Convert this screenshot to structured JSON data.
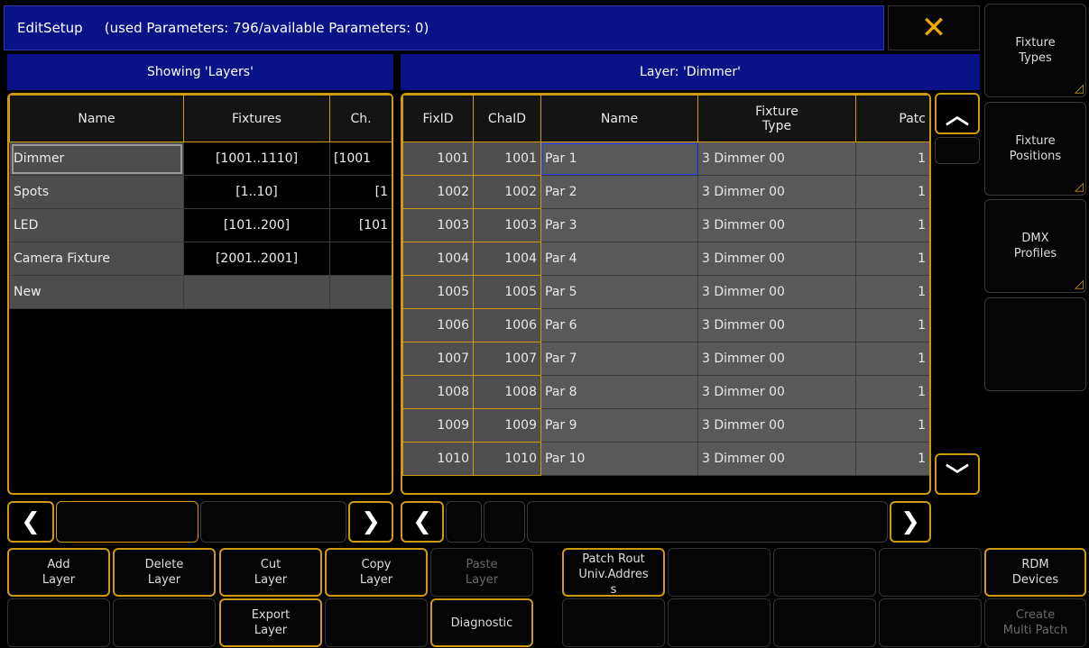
{
  "title": {
    "app": "EditSetup",
    "info": "(used Parameters: 796/available Parameters: 0)"
  },
  "close_label": "✕",
  "left": {
    "header": "Showing 'Layers'",
    "columns": [
      "Name",
      "Fixtures",
      "Ch."
    ],
    "rows": [
      {
        "name": "Dimmer",
        "fixtures": "[1001..1110]",
        "ch": "[1001"
      },
      {
        "name": "Spots",
        "fixtures": "[1..10]",
        "ch": "[1"
      },
      {
        "name": "LED",
        "fixtures": "[101..200]",
        "ch": "[101"
      },
      {
        "name": "Camera Fixture",
        "fixtures": "[2001..2001]",
        "ch": ""
      },
      {
        "name": "New",
        "fixtures": "",
        "ch": ""
      }
    ]
  },
  "right": {
    "header": "Layer: 'Dimmer'",
    "columns": [
      "FixID",
      "ChaID",
      "Name",
      "Fixture\nType",
      "Patc"
    ],
    "rows": [
      {
        "fix": "1001",
        "cha": "1001",
        "name": "Par 1",
        "type": "3 Dimmer 00",
        "patch": "1"
      },
      {
        "fix": "1002",
        "cha": "1002",
        "name": "Par 2",
        "type": "3 Dimmer 00",
        "patch": "1"
      },
      {
        "fix": "1003",
        "cha": "1003",
        "name": "Par 3",
        "type": "3 Dimmer 00",
        "patch": "1"
      },
      {
        "fix": "1004",
        "cha": "1004",
        "name": "Par 4",
        "type": "3 Dimmer 00",
        "patch": "1"
      },
      {
        "fix": "1005",
        "cha": "1005",
        "name": "Par 5",
        "type": "3 Dimmer 00",
        "patch": "1"
      },
      {
        "fix": "1006",
        "cha": "1006",
        "name": "Par 6",
        "type": "3 Dimmer 00",
        "patch": "1"
      },
      {
        "fix": "1007",
        "cha": "1007",
        "name": "Par 7",
        "type": "3 Dimmer 00",
        "patch": "1"
      },
      {
        "fix": "1008",
        "cha": "1008",
        "name": "Par 8",
        "type": "3 Dimmer 00",
        "patch": "1"
      },
      {
        "fix": "1009",
        "cha": "1009",
        "name": "Par 9",
        "type": "3 Dimmer 00",
        "patch": "1"
      },
      {
        "fix": "1010",
        "cha": "1010",
        "name": "Par 10",
        "type": "3 Dimmer 00",
        "patch": "1"
      }
    ]
  },
  "side": {
    "fixture_types": "Fixture\nTypes",
    "fixture_positions": "Fixture\nPositions",
    "dmx_profiles": "DMX\nProfiles",
    "rdm_devices": "RDM\nDevices",
    "create_multi_patch": "Create\nMulti Patch"
  },
  "buttons": {
    "add_layer": "Add\nLayer",
    "delete_layer": "Delete\nLayer",
    "cut_layer": "Cut\nLayer",
    "copy_layer": "Copy\nLayer",
    "paste_layer": "Paste\nLayer",
    "patch_route": "Patch Rout\nUniv.Addres\ns",
    "export_layer": "Export\nLayer",
    "diagnostic": "Diagnostic"
  },
  "icons": {
    "left": "chevron-left-icon",
    "right": "chevron-right-icon",
    "up": "chevron-up-icon",
    "down": "chevron-down-icon",
    "close": "close-icon"
  },
  "colors": {
    "accent": "#d09a10",
    "title_bg": "#0a1287",
    "cell": "#595959"
  }
}
